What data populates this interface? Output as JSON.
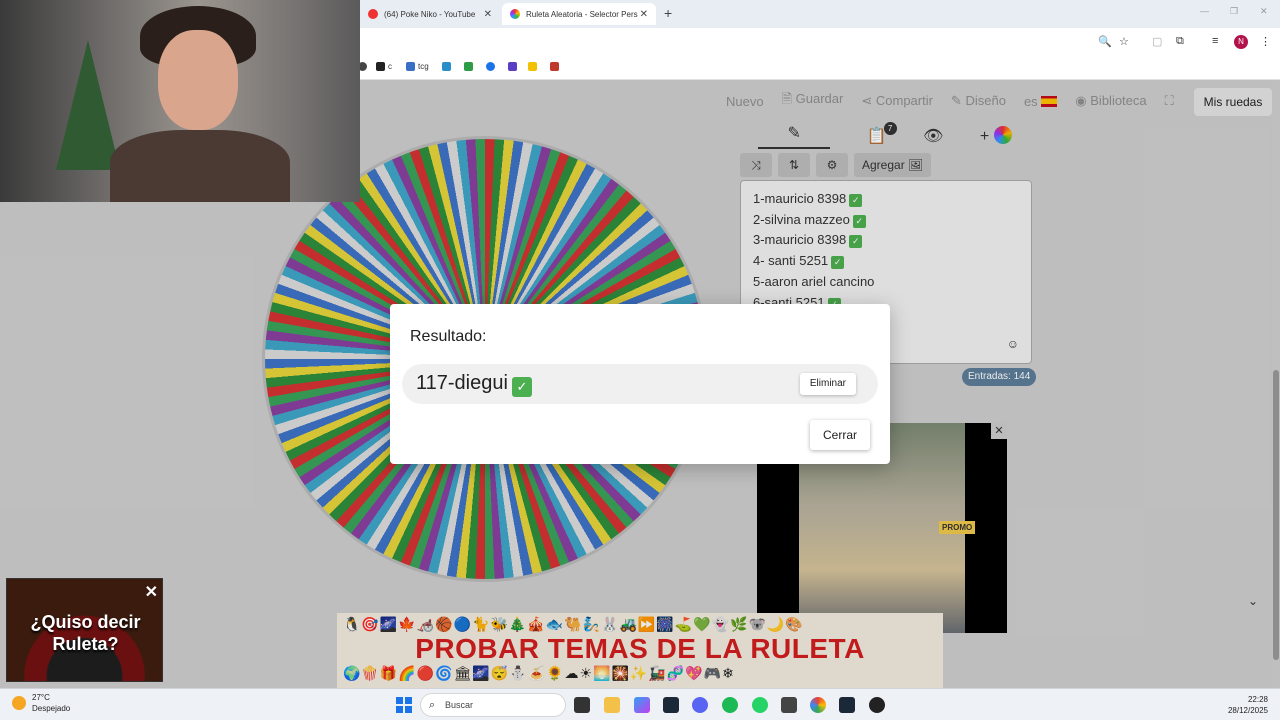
{
  "browser": {
    "tabs": [
      {
        "label": "(64) Poke Niko - YouTube"
      },
      {
        "label": "Ruleta Aleatoria - Selector Pers"
      }
    ],
    "bookmarks": [
      {
        "label": "c"
      },
      {
        "label": "tcg"
      }
    ],
    "profile_initial": "N"
  },
  "toolbar": {
    "nuevo": "Nuevo",
    "guardar": "Guardar",
    "compartir": "Compartir",
    "diseno": "Diseño",
    "lang": "es",
    "biblioteca": "Biblioteca",
    "mis_ruedas": "Mis ruedas"
  },
  "panel": {
    "tab_badge": "7",
    "agregar_label": "Agregar",
    "entries": [
      {
        "text": "1-mauricio 8398",
        "checked": true
      },
      {
        "text": "2-silvina mazzeo",
        "checked": true
      },
      {
        "text": "3-mauricio 8398",
        "checked": true
      },
      {
        "text": "4- santi 5251",
        "checked": true
      },
      {
        "text": "5-aaron ariel cancino",
        "checked": false
      },
      {
        "text": "6-santi 5251",
        "checked": true
      }
    ],
    "count_label": "Entradas: 144"
  },
  "ad": {
    "badge": "PROMO"
  },
  "banner": {
    "title": "PROBAR TEMAS DE LA RULETA",
    "emojis_top": "🐧🎯🌌🍁🦽🏀🔵🐈🐝🎄🎪🐟🐫🧞🐰🚜⏩🎆⛳💚👻🌿🐨🌙🎨",
    "emojis_bottom": "🌍🍿🎁🌈🔴🌀🏛🌌😴⛄🍝🌻☁☀🌅🎇✨🚂🧬💖🎮❄"
  },
  "modal": {
    "title": "Resultado:",
    "result": "117-diegui",
    "eliminar": "Eliminar",
    "cerrar": "Cerrar"
  },
  "promo": {
    "text": "¿Quiso decir Ruleta?"
  },
  "taskbar": {
    "temperature": "27°C",
    "condition": "Despejado",
    "search_placeholder": "Buscar",
    "time": "22:28",
    "date": "28/12/2025"
  },
  "colors": {
    "checkmark": "#4caf50",
    "banner_title": "#d21e1e",
    "count_badge": "#5d7d99"
  }
}
